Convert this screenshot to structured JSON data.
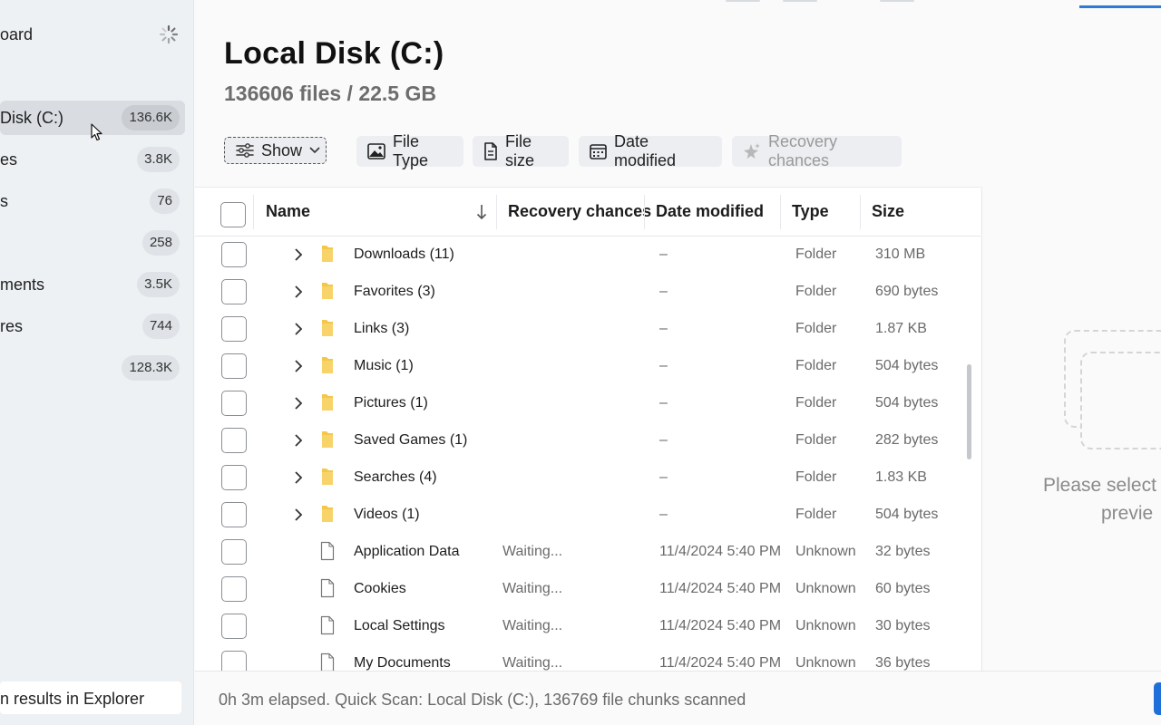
{
  "sidebar": {
    "top_label": "oard",
    "items": [
      {
        "label": "Disk (C:)",
        "count": "136.6K",
        "active": true
      },
      {
        "label": "es",
        "count": "3.8K"
      },
      {
        "label": "s",
        "count": "76"
      },
      {
        "label": "",
        "count": "258"
      },
      {
        "label": "ments",
        "count": "3.5K"
      },
      {
        "label": "res",
        "count": "744"
      },
      {
        "label": "",
        "count": "128.3K"
      }
    ],
    "bottom_label": "n results in Explorer"
  },
  "header": {
    "title": "Local Disk (C:)",
    "subtitle": "136606 files / 22.5 GB"
  },
  "filters": {
    "show": "Show",
    "file_type": "File Type",
    "file_size": "File size",
    "date_modified": "Date modified",
    "recovery_chances": "Recovery chances"
  },
  "table": {
    "columns": {
      "name": "Name",
      "recovery": "Recovery chances",
      "date": "Date modified",
      "type": "Type",
      "size": "Size"
    },
    "rows": [
      {
        "kind": "folder",
        "name": "Downloads (11)",
        "recovery": "",
        "date": "–",
        "type": "Folder",
        "size": "310 MB"
      },
      {
        "kind": "folder",
        "name": "Favorites (3)",
        "recovery": "",
        "date": "–",
        "type": "Folder",
        "size": "690 bytes"
      },
      {
        "kind": "folder",
        "name": "Links (3)",
        "recovery": "",
        "date": "–",
        "type": "Folder",
        "size": "1.87 KB"
      },
      {
        "kind": "folder",
        "name": "Music (1)",
        "recovery": "",
        "date": "–",
        "type": "Folder",
        "size": "504 bytes"
      },
      {
        "kind": "folder",
        "name": "Pictures (1)",
        "recovery": "",
        "date": "–",
        "type": "Folder",
        "size": "504 bytes"
      },
      {
        "kind": "folder",
        "name": "Saved Games (1)",
        "recovery": "",
        "date": "–",
        "type": "Folder",
        "size": "282 bytes"
      },
      {
        "kind": "folder",
        "name": "Searches (4)",
        "recovery": "",
        "date": "–",
        "type": "Folder",
        "size": "1.83 KB"
      },
      {
        "kind": "folder",
        "name": "Videos (1)",
        "recovery": "",
        "date": "–",
        "type": "Folder",
        "size": "504 bytes"
      },
      {
        "kind": "file",
        "name": "Application Data",
        "recovery": "Waiting...",
        "date": "11/4/2024 5:40 PM",
        "type": "Unknown",
        "size": "32 bytes"
      },
      {
        "kind": "file",
        "name": "Cookies",
        "recovery": "Waiting...",
        "date": "11/4/2024 5:40 PM",
        "type": "Unknown",
        "size": "60 bytes"
      },
      {
        "kind": "file",
        "name": "Local Settings",
        "recovery": "Waiting...",
        "date": "11/4/2024 5:40 PM",
        "type": "Unknown",
        "size": "30 bytes"
      },
      {
        "kind": "file",
        "name": "My Documents",
        "recovery": "Waiting...",
        "date": "11/4/2024 5:40 PM",
        "type": "Unknown",
        "size": "36 bytes"
      }
    ]
  },
  "preview": {
    "message_line1": "Please select",
    "message_line2": "previe"
  },
  "status": {
    "text": "0h 3m elapsed. Quick Scan: Local Disk (C:), 136769 file chunks scanned"
  },
  "colors": {
    "accent": "#2f7ad6",
    "folder": "#f4c74a",
    "sidebar_bg": "#eef1f4"
  },
  "icons": {
    "loading": "spinner-icon",
    "show": "sliders-icon",
    "file_type": "image-icon",
    "file_size": "document-icon",
    "date_modified": "calendar-icon",
    "recovery_chances": "sparkle-star-icon",
    "sort": "arrow-down-icon",
    "expand": "chevron-right-icon",
    "folder": "folder-icon",
    "file": "file-icon"
  }
}
